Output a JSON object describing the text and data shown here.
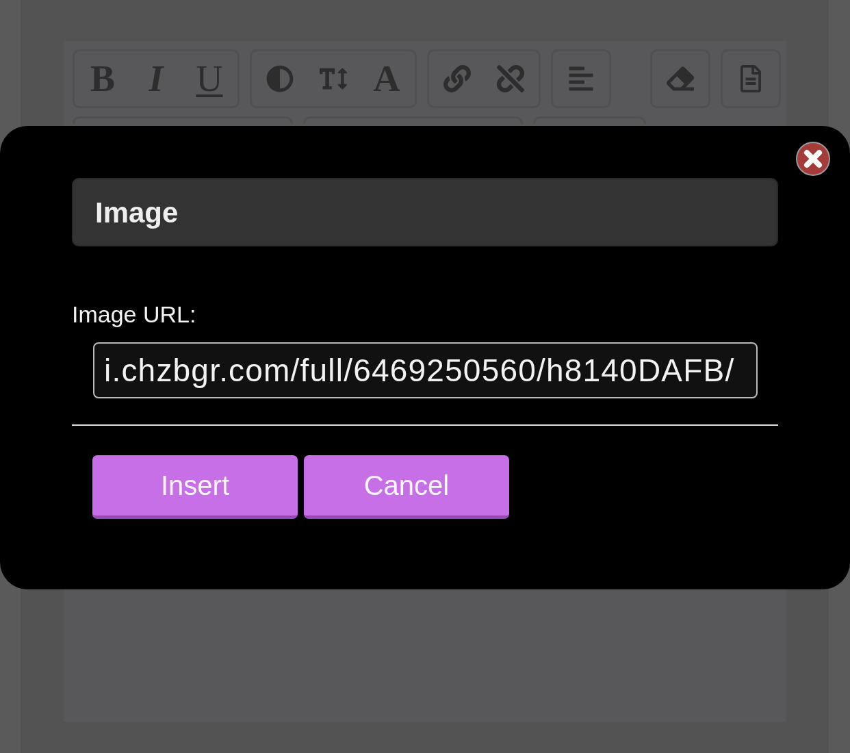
{
  "toolbar": {
    "groups": [
      {
        "buttons": [
          {
            "kind": "bold",
            "label": "B"
          },
          {
            "kind": "italic",
            "label": "I"
          },
          {
            "kind": "underline",
            "label": "U"
          }
        ]
      },
      {
        "buttons": [
          {
            "kind": "contrast"
          },
          {
            "kind": "text-height"
          },
          {
            "kind": "font-color",
            "label": "A"
          }
        ]
      },
      {
        "buttons": [
          {
            "kind": "link"
          },
          {
            "kind": "unlink"
          }
        ]
      },
      {
        "buttons": [
          {
            "kind": "align-left"
          }
        ]
      },
      {
        "buttons": [
          {
            "kind": "eraser"
          }
        ]
      },
      {
        "buttons": [
          {
            "kind": "document"
          }
        ]
      }
    ]
  },
  "dialog": {
    "title": "Image",
    "field": {
      "label": "Image URL:",
      "value": "i.chzbgr.com/full/6469250560/h8140DAFB/"
    },
    "buttons": [
      "Insert",
      "Cancel"
    ]
  }
}
